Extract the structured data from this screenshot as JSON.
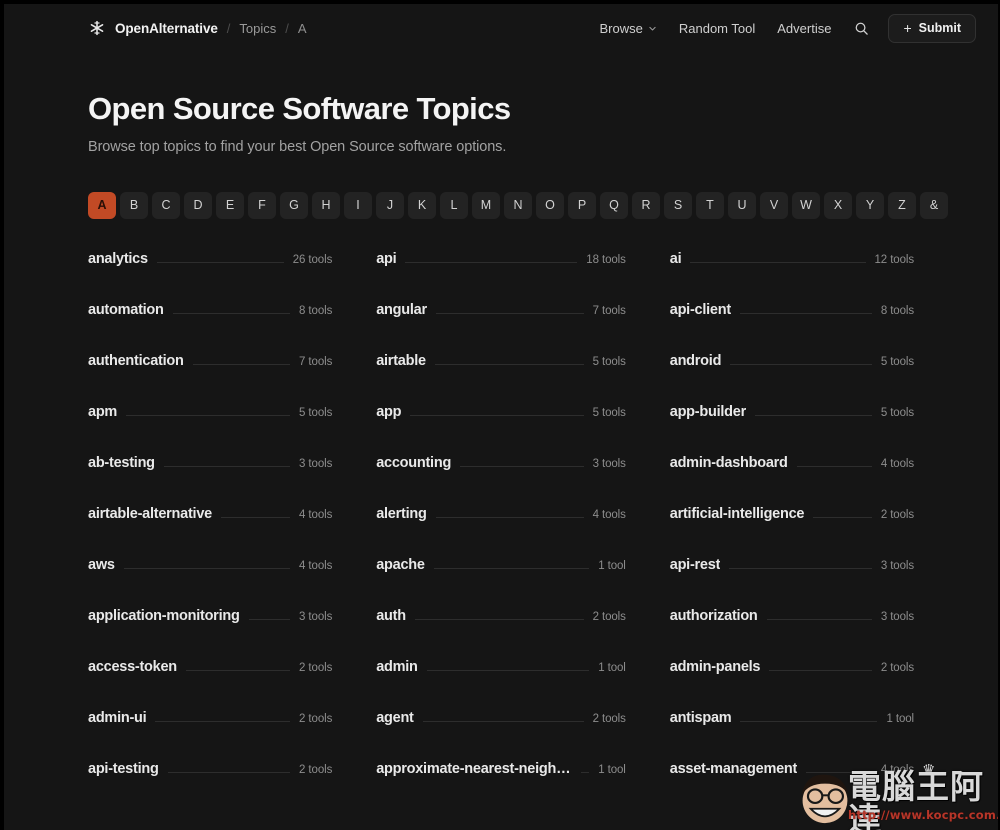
{
  "header": {
    "logo_icon": "asterisk-logo-icon",
    "brand": "OpenAlternative",
    "breadcrumb": [
      "Topics",
      "A"
    ],
    "separator": "/",
    "nav": [
      {
        "label": "Browse",
        "has_chevron": true
      },
      {
        "label": "Random Tool",
        "has_chevron": false
      },
      {
        "label": "Advertise",
        "has_chevron": false
      }
    ],
    "search_icon": "search-icon",
    "submit": {
      "plus": "+",
      "label": "Submit"
    }
  },
  "hero": {
    "title": "Open Source Software Topics",
    "subtitle": "Browse top topics to find your best Open Source software options."
  },
  "alphabet": {
    "active": "A",
    "letters": [
      "A",
      "B",
      "C",
      "D",
      "E",
      "F",
      "G",
      "H",
      "I",
      "J",
      "K",
      "L",
      "M",
      "N",
      "O",
      "P",
      "Q",
      "R",
      "S",
      "T",
      "U",
      "V",
      "W",
      "X",
      "Y",
      "Z",
      "&"
    ]
  },
  "topics": {
    "columns": [
      [
        {
          "name": "analytics",
          "count": "26 tools"
        },
        {
          "name": "automation",
          "count": "8 tools"
        },
        {
          "name": "authentication",
          "count": "7 tools"
        },
        {
          "name": "apm",
          "count": "5 tools"
        },
        {
          "name": "ab-testing",
          "count": "3 tools"
        },
        {
          "name": "airtable-alternative",
          "count": "4 tools"
        },
        {
          "name": "aws",
          "count": "4 tools"
        },
        {
          "name": "application-monitoring",
          "count": "3 tools"
        },
        {
          "name": "access-token",
          "count": "2 tools"
        },
        {
          "name": "admin-ui",
          "count": "2 tools"
        },
        {
          "name": "api-testing",
          "count": "2 tools"
        }
      ],
      [
        {
          "name": "api",
          "count": "18 tools"
        },
        {
          "name": "angular",
          "count": "7 tools"
        },
        {
          "name": "airtable",
          "count": "5 tools"
        },
        {
          "name": "app",
          "count": "5 tools"
        },
        {
          "name": "accounting",
          "count": "3 tools"
        },
        {
          "name": "alerting",
          "count": "4 tools"
        },
        {
          "name": "apache",
          "count": "1 tool"
        },
        {
          "name": "auth",
          "count": "2 tools"
        },
        {
          "name": "admin",
          "count": "1 tool"
        },
        {
          "name": "agent",
          "count": "2 tools"
        },
        {
          "name": "approximate-nearest-neighbor",
          "count": "1 tool"
        }
      ],
      [
        {
          "name": "ai",
          "count": "12 tools"
        },
        {
          "name": "api-client",
          "count": "8 tools"
        },
        {
          "name": "android",
          "count": "5 tools"
        },
        {
          "name": "app-builder",
          "count": "5 tools"
        },
        {
          "name": "admin-dashboard",
          "count": "4 tools"
        },
        {
          "name": "artificial-intelligence",
          "count": "2 tools"
        },
        {
          "name": "api-rest",
          "count": "3 tools"
        },
        {
          "name": "authorization",
          "count": "3 tools"
        },
        {
          "name": "admin-panels",
          "count": "2 tools"
        },
        {
          "name": "antispam",
          "count": "1 tool"
        },
        {
          "name": "asset-management",
          "count": "4 tools"
        }
      ]
    ]
  },
  "watermark": {
    "text": "電腦王阿達",
    "url": "http://www.kocpc.com.tw"
  },
  "colors": {
    "page_bg": "#151515",
    "accent": "#c24a25",
    "text_primary": "#f2f2f2",
    "text_muted": "#8d8d8d",
    "rule": "#2d2d2d"
  }
}
